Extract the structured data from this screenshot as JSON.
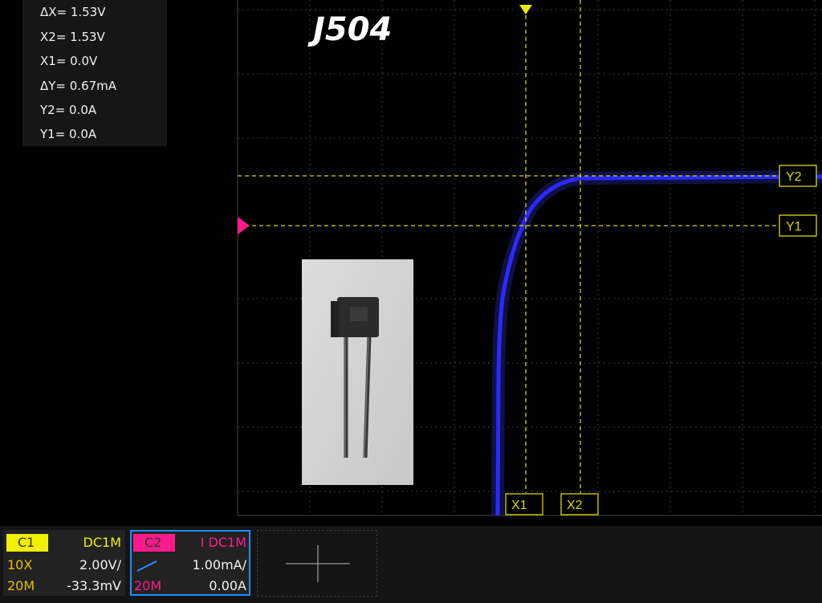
{
  "title": "J504",
  "cursor_readout": {
    "dx": "ΔX= 1.53V",
    "x2": "X2= 1.53V",
    "x1": "X1= 0.0V",
    "dy": "ΔY= 0.67mA",
    "y2": "Y2= 0.0A",
    "y1": "Y1= 0.0A"
  },
  "cursor_labels": {
    "x1": "X1",
    "x2": "X2",
    "y1": "Y1",
    "y2": "Y2"
  },
  "colors": {
    "trace": "#2a2aff",
    "cursor": "#d8d800",
    "trigger_marker": "#ff1a8c",
    "ch1": "#f0f000",
    "ch2": "#ff1a8c",
    "grid": "#3a3a3a"
  },
  "channel1": {
    "name": "C1",
    "coupling": "DC1M",
    "probe": "10X",
    "scale": "2.00V/",
    "bandwidth": "20M",
    "offset": "-33.3mV"
  },
  "channel2": {
    "name": "C2",
    "coupling": "I DC1M",
    "scale": "1.00mA/",
    "bandwidth": "20M",
    "offset": "0.00A"
  },
  "add_channel_icon": "plus-icon",
  "photo": "jfet-transistor-photo"
}
